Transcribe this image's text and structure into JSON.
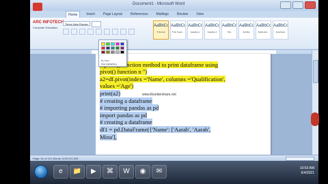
{
  "window": {
    "title": "Document1 - Microsoft Word"
  },
  "brand": {
    "name": "ARC INFOTECH",
    "tagline": "Computer Education"
  },
  "tabs": [
    "Home",
    "Insert",
    "Page Layout",
    "References",
    "Mailings",
    "Review",
    "View"
  ],
  "ribbon": {
    "font_name": "Times New Roman",
    "groups": [
      "Clipboard",
      "Font",
      "Paragraph",
      "Styles",
      "Editing"
    ],
    "styles": [
      {
        "preview": "AaBbCcDc",
        "name": "¶ Normal"
      },
      {
        "preview": "AaBbCcDc",
        "name": "¶ No Spaci..."
      },
      {
        "preview": "AaBbCc",
        "name": "Heading 1"
      },
      {
        "preview": "AaBbCc",
        "name": "Heading 2"
      },
      {
        "preview": "AaBbCc",
        "name": "Title"
      },
      {
        "preview": "AaBbCcD",
        "name": "Subtitle"
      },
      {
        "preview": "AaBbCcDc",
        "name": "Subtle Em..."
      },
      {
        "preview": "AaBbCcDc",
        "name": "Emphasis"
      }
    ]
  },
  "highlight_palette": {
    "colors": [
      "#f5ee28",
      "#23e823",
      "#2ee8e8",
      "#f01ef0",
      "#1e3cf0",
      "#e82323",
      "#1a2c8a",
      "#1a8a8a",
      "#1a8a1a",
      "#8a1a8a",
      "#8a1a1a",
      "#8a8a1a",
      "#8a8a8a",
      "#c0c0c0",
      "#000000"
    ],
    "no_color_label": "No Color",
    "stop_label": "Stop Highlighting"
  },
  "document": {
    "lines": [
      {
        "text": "print(a1)",
        "style": "hl"
      },
      {
        "text": "# pivot() function method to print dataframe using",
        "style": "hl"
      },
      {
        "text": "pivot() function  n \")",
        "style": "hl"
      },
      {
        "text": "a2=df.pivot(index ='Name', columns ='Qualification',",
        "style": "hl"
      },
      {
        "text": "values ='Age')",
        "style": "hl"
      },
      {
        "text": "print(a2)",
        "style": "sel"
      },
      {
        "text": "# creating a dataframe",
        "style": "sel"
      },
      {
        "text": "# importing pandas as pd",
        "style": "sel"
      },
      {
        "text": "import pandas as pd",
        "style": "sel"
      },
      {
        "text": "# creating a dataframe",
        "style": "sel"
      },
      {
        "text": "df1 = pd.DataFrame({'Name': ['Aarab', 'Aarab',",
        "style": "sel"
      },
      {
        "text": "Mina'],",
        "style": "sel"
      }
    ],
    "watermark": "www.thundershare.net"
  },
  "statusbar": {
    "text": "Page: 61 of 101   Words: 5,507/22,305"
  },
  "taskbar": {
    "items": [
      "e",
      "📁",
      "▶",
      "⌘",
      "W",
      "◉",
      "✉"
    ],
    "time": "10:53 AM",
    "date": "6/4/2021"
  }
}
